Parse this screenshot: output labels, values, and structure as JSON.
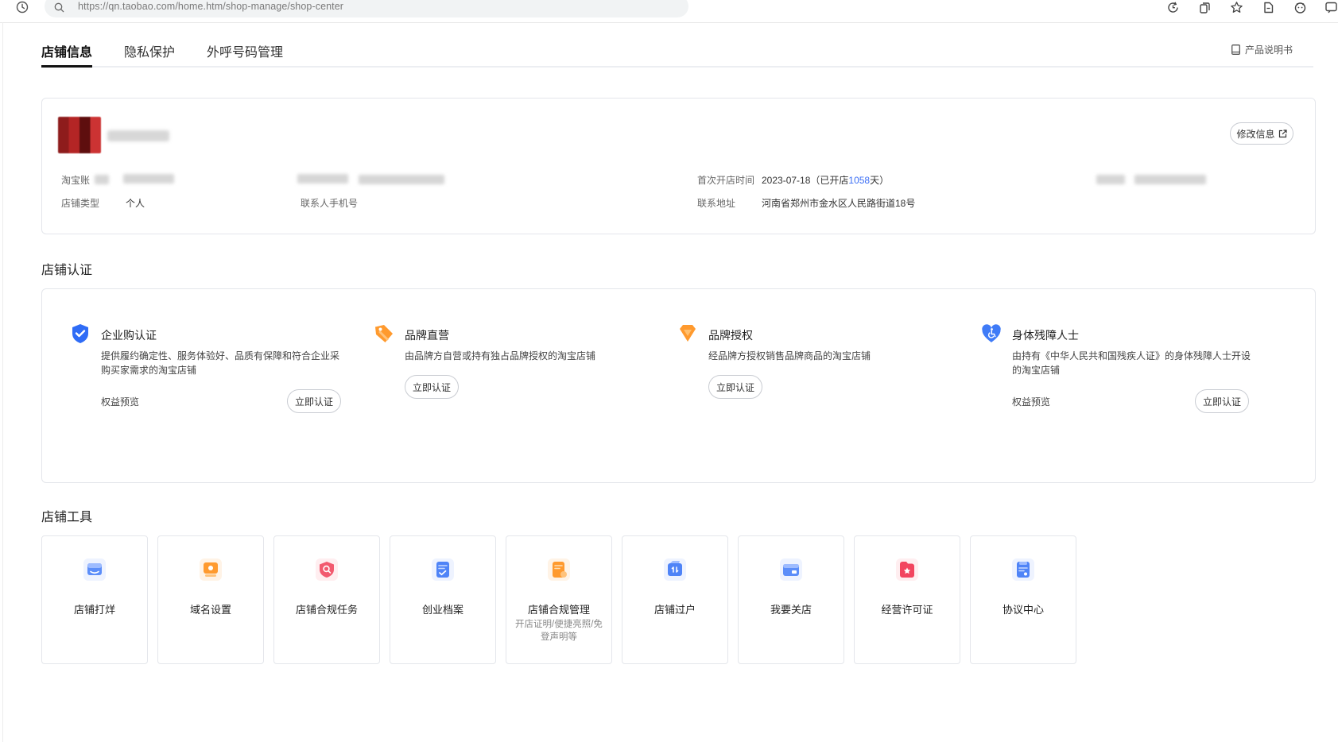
{
  "browser": {
    "url": "https://qn.taobao.com/home.htm/shop-manage/shop-center"
  },
  "tabs": [
    {
      "label": "店铺信息",
      "active": true
    },
    {
      "label": "隐私保护",
      "active": false
    },
    {
      "label": "外呼号码管理",
      "active": false
    }
  ],
  "manual_link": "产品说明书",
  "shop_info": {
    "edit_button": "修改信息",
    "taobao_account_label": "淘宝账",
    "shop_type_label": "店铺类型",
    "shop_type_value": "个人",
    "contact_phone_label": "联系人手机号",
    "open_time_label": "首次开店时间",
    "open_time_date": "2023-07-18",
    "open_days_prefix": "（已开店",
    "open_days_count": "1058",
    "open_days_suffix": "天）",
    "address_label": "联系地址",
    "address_value": "河南省郑州市金水区人民路街道18号"
  },
  "certification": {
    "title": "店铺认证",
    "items": [
      {
        "title": "企业购认证",
        "desc": "提供履约确定性、服务体验好、品质有保障和符合企业采购买家需求的淘宝店铺",
        "benefit": "权益预览",
        "button": "立即认证"
      },
      {
        "title": "品牌直营",
        "desc": "由品牌方自营或持有独占品牌授权的淘宝店铺",
        "button": "立即认证"
      },
      {
        "title": "品牌授权",
        "desc": "经品牌方授权销售品牌商品的淘宝店铺",
        "button": "立即认证"
      },
      {
        "title": "身体残障人士",
        "desc": "由持有《中华人民共和国残疾人证》的身体残障人士开设的淘宝店铺",
        "benefit": "权益预览",
        "button": "立即认证"
      }
    ]
  },
  "tools": {
    "title": "店铺工具",
    "items": [
      {
        "label": "店铺打烊",
        "icon": "shop-close-icon"
      },
      {
        "label": "域名设置",
        "icon": "domain-icon"
      },
      {
        "label": "店铺合规任务",
        "icon": "compliance-task-icon"
      },
      {
        "label": "创业档案",
        "icon": "startup-file-icon"
      },
      {
        "label": "店铺合规管理",
        "sub": "开店证明/便捷亮照/免登声明等",
        "icon": "compliance-manage-icon"
      },
      {
        "label": "店铺过户",
        "icon": "shop-transfer-icon"
      },
      {
        "label": "我要关店",
        "icon": "close-shop-icon"
      },
      {
        "label": "经营许可证",
        "icon": "license-icon"
      },
      {
        "label": "协议中心",
        "icon": "agreement-icon"
      }
    ]
  },
  "colors": {
    "link_blue": "#3b6ef5",
    "shield_blue": "#2f6cf6",
    "brand_orange": "#ff9a2e",
    "heart_blue": "#3f7bf7"
  }
}
